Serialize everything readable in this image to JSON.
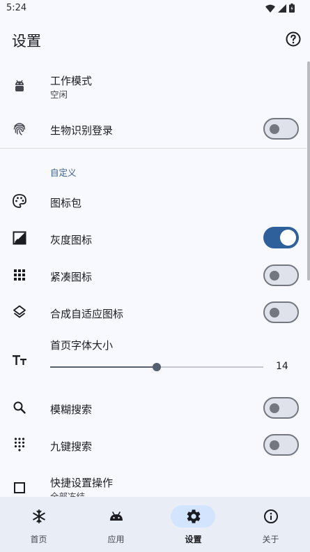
{
  "status_bar": {
    "time": "5:24"
  },
  "top_bar": {
    "title": "设置"
  },
  "settings": {
    "work_mode": {
      "label": "工作模式",
      "value": "空闲"
    },
    "biometric_login": {
      "label": "生物识别登录",
      "enabled": false
    },
    "section_custom": "自定义",
    "icon_pack": {
      "label": "图标包"
    },
    "gray_icons": {
      "label": "灰度图标",
      "enabled": true
    },
    "compact_icons": {
      "label": "紧凑图标",
      "enabled": false
    },
    "adaptive_icons": {
      "label": "合成自适应图标",
      "enabled": false
    },
    "home_font_size": {
      "label": "首页字体大小",
      "value": 14,
      "min": 8,
      "max": 20
    },
    "fuzzy_search": {
      "label": "模糊搜索",
      "enabled": false
    },
    "t9_search": {
      "label": "九键搜索",
      "enabled": false
    },
    "quick_settings": {
      "label": "快捷设置操作",
      "value": "全部冻结"
    }
  },
  "nav": {
    "items": [
      {
        "label": "首页",
        "icon": "snowflake-icon"
      },
      {
        "label": "应用",
        "icon": "android-icon"
      },
      {
        "label": "设置",
        "icon": "gear-icon",
        "active": true
      },
      {
        "label": "关于",
        "icon": "info-icon"
      }
    ]
  },
  "colors": {
    "accent": "#2e609b",
    "background": "#f7f9ff",
    "nav_background": "#e9edf6",
    "nav_active": "#d3e4ff"
  }
}
